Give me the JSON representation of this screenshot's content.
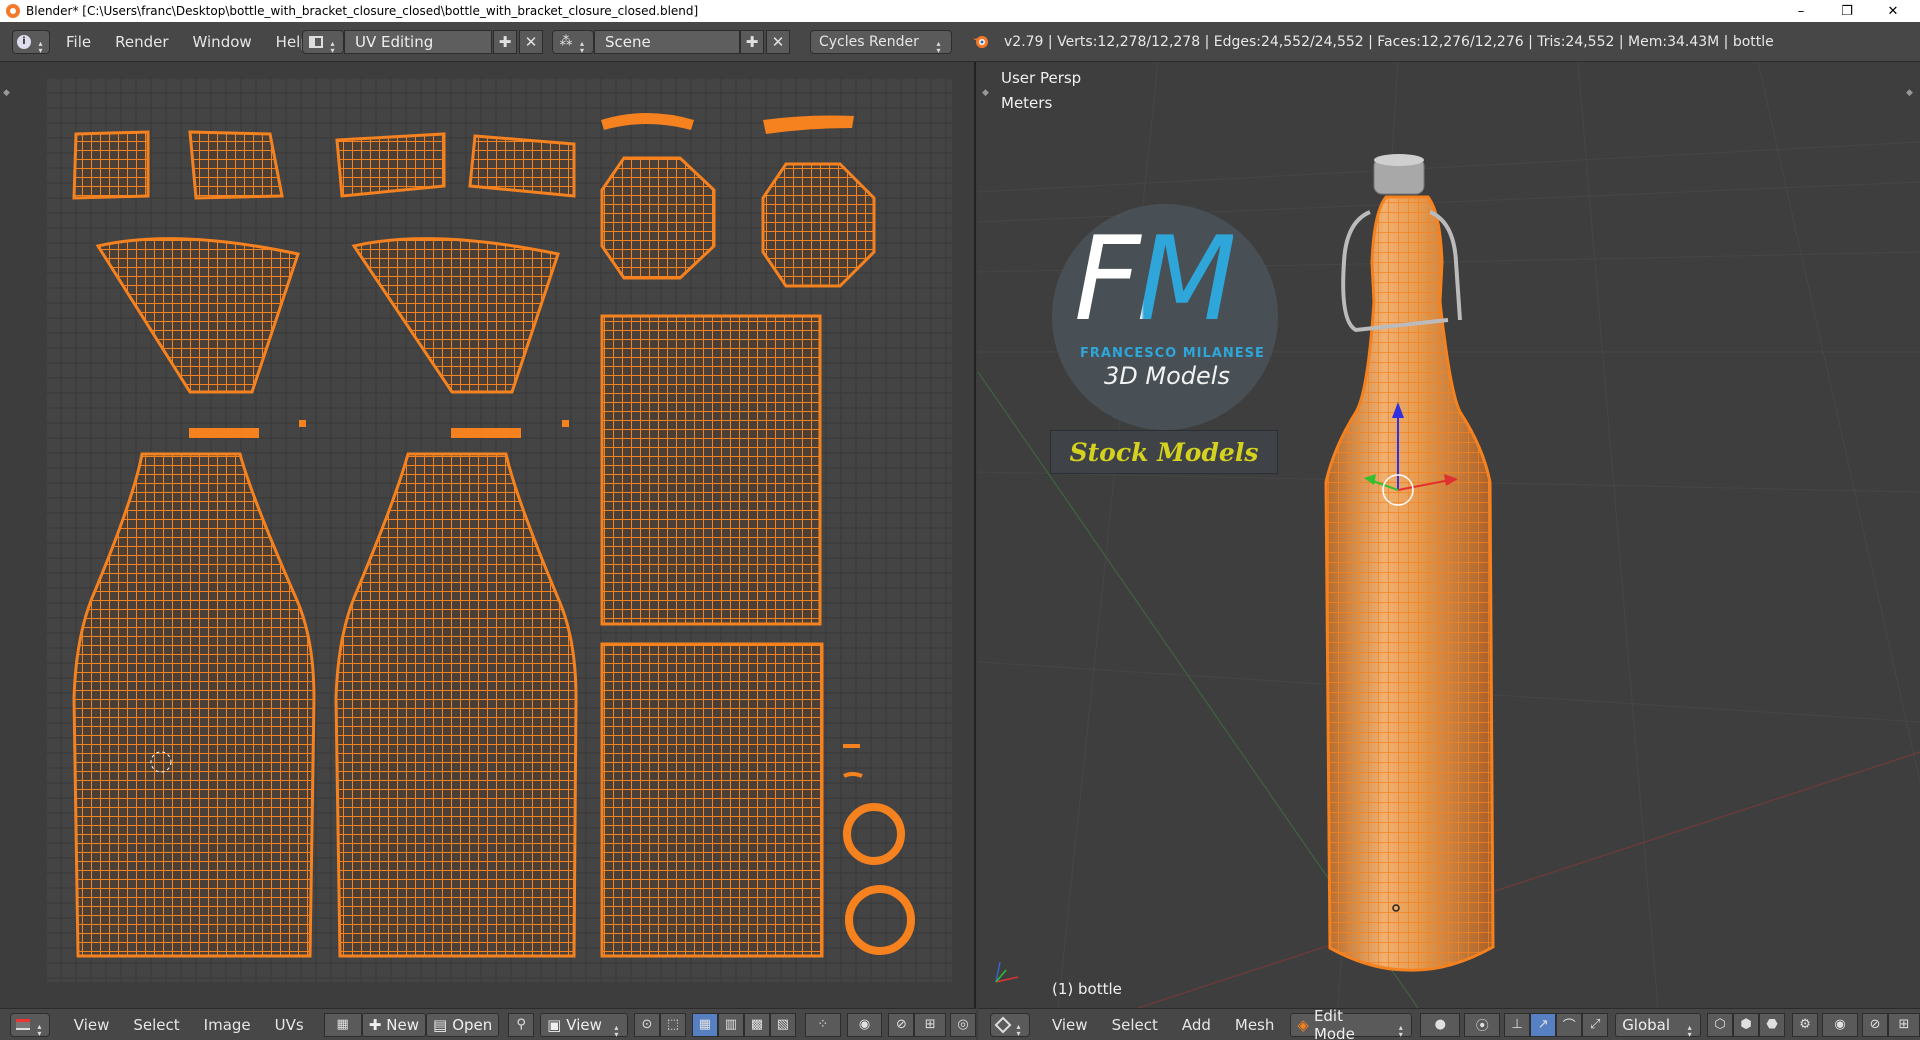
{
  "window": {
    "title": "Blender* [C:\\Users\\franc\\Desktop\\bottle_with_bracket_closure_closed\\bottle_with_bracket_closure_closed.blend]",
    "minimize": "–",
    "restore": "❐",
    "close": "✕"
  },
  "info_header": {
    "menu": [
      "File",
      "Render",
      "Window",
      "Help"
    ],
    "screen_layout": "UV Editing",
    "scene": "Scene",
    "render_engine": "Cycles Render",
    "stats": "v2.79 | Verts:12,278/12,278 | Edges:24,552/24,552 | Faces:12,276/12,276 | Tris:24,552 | Mem:34.43M | bottle"
  },
  "uv_editor": {
    "bottom_menu": [
      "View",
      "Select",
      "Image",
      "UVs"
    ],
    "new_label": "New",
    "open_label": "Open",
    "view_label": "View"
  },
  "viewport": {
    "view_name": "User Persp",
    "units": "Meters",
    "object_label": "(1) bottle",
    "bottom_menu": [
      "View",
      "Select",
      "Add",
      "Mesh"
    ],
    "mode": "Edit Mode",
    "orientation": "Global"
  },
  "watermark": {
    "logo_letters": "FM",
    "brand_name": "FRANCESCO MILANESE",
    "tagline": "3D Models",
    "banner": "Stock Models"
  },
  "colors": {
    "accent_orange": "#f5821f",
    "bg_panel": "#3d3d3d",
    "header": "#474747",
    "banner_text": "#d4d21e",
    "logo_blue": "#2fa6d9"
  }
}
